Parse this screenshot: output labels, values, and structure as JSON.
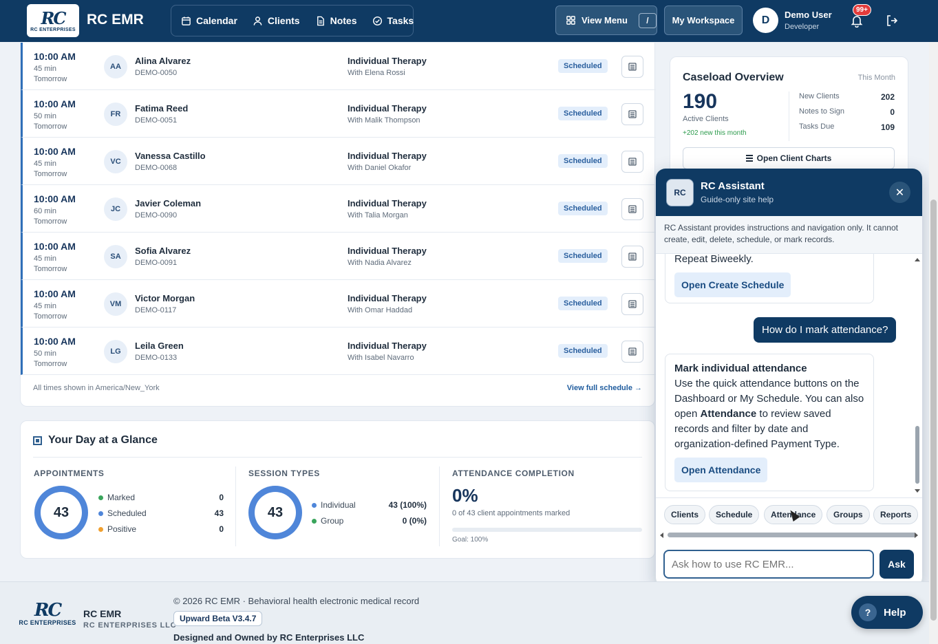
{
  "header": {
    "logo_text": "RC",
    "logo_sub": "RC ENTERPRISES",
    "app_title": "RC EMR",
    "nav": [
      {
        "label": "Calendar",
        "icon": "calendar-icon"
      },
      {
        "label": "Clients",
        "icon": "user-icon"
      },
      {
        "label": "Notes",
        "icon": "document-icon"
      },
      {
        "label": "Tasks",
        "icon": "check-circle-icon"
      }
    ],
    "view_menu_label": "View Menu",
    "view_menu_shortcut": "/",
    "workspace_label": "My Workspace",
    "user_initial": "D",
    "user_name": "Demo User",
    "user_role": "Developer",
    "notification_badge": "99+"
  },
  "appointments": {
    "rows": [
      {
        "time": "10:00 AM",
        "duration": "45 min",
        "day": "Tomorrow",
        "initials": "AA",
        "name": "Alina Alvarez",
        "client_id": "DEMO-0050",
        "type": "Individual Therapy",
        "with": "With Elena Rossi",
        "status": "Scheduled"
      },
      {
        "time": "10:00 AM",
        "duration": "50 min",
        "day": "Tomorrow",
        "initials": "FR",
        "name": "Fatima Reed",
        "client_id": "DEMO-0051",
        "type": "Individual Therapy",
        "with": "With Malik Thompson",
        "status": "Scheduled"
      },
      {
        "time": "10:00 AM",
        "duration": "45 min",
        "day": "Tomorrow",
        "initials": "VC",
        "name": "Vanessa Castillo",
        "client_id": "DEMO-0068",
        "type": "Individual Therapy",
        "with": "With Daniel Okafor",
        "status": "Scheduled"
      },
      {
        "time": "10:00 AM",
        "duration": "60 min",
        "day": "Tomorrow",
        "initials": "JC",
        "name": "Javier Coleman",
        "client_id": "DEMO-0090",
        "type": "Individual Therapy",
        "with": "With Talia Morgan",
        "status": "Scheduled"
      },
      {
        "time": "10:00 AM",
        "duration": "45 min",
        "day": "Tomorrow",
        "initials": "SA",
        "name": "Sofia Alvarez",
        "client_id": "DEMO-0091",
        "type": "Individual Therapy",
        "with": "With Nadia Alvarez",
        "status": "Scheduled"
      },
      {
        "time": "10:00 AM",
        "duration": "45 min",
        "day": "Tomorrow",
        "initials": "VM",
        "name": "Victor Morgan",
        "client_id": "DEMO-0117",
        "type": "Individual Therapy",
        "with": "With Omar Haddad",
        "status": "Scheduled"
      },
      {
        "time": "10:00 AM",
        "duration": "50 min",
        "day": "Tomorrow",
        "initials": "LG",
        "name": "Leila Green",
        "client_id": "DEMO-0133",
        "type": "Individual Therapy",
        "with": "With Isabel Navarro",
        "status": "Scheduled"
      }
    ],
    "timezone_note": "All times shown in America/New_York",
    "full_schedule_link": "View full schedule →"
  },
  "glance": {
    "title": "Your Day at a Glance",
    "appointments_heading": "APPOINTMENTS",
    "appointments_total": "43",
    "appointments_legend": [
      {
        "label": "Marked",
        "value": "0",
        "color": "#3aa55c"
      },
      {
        "label": "Scheduled",
        "value": "43",
        "color": "#4f86d9"
      },
      {
        "label": "Positive",
        "value": "0",
        "color": "#f0a030"
      }
    ],
    "session_heading": "SESSION TYPES",
    "session_total": "43",
    "session_legend": [
      {
        "label": "Individual",
        "value": "43 (100%)",
        "color": "#4f86d9"
      },
      {
        "label": "Group",
        "value": "0 (0%)",
        "color": "#3aa55c"
      }
    ],
    "attendance_heading": "ATTENDANCE COMPLETION",
    "attendance_pct": "0%",
    "attendance_fraction": 0,
    "attendance_sub": "0 of 43 client appointments marked",
    "attendance_goal": "Goal: 100%"
  },
  "caseload": {
    "title": "Caseload Overview",
    "period": "This Month",
    "active_count": "190",
    "active_label": "Active Clients",
    "new_this_month": "+202 new this month",
    "stats": [
      {
        "label": "New Clients",
        "value": "202"
      },
      {
        "label": "Notes to Sign",
        "value": "0"
      },
      {
        "label": "Tasks Due",
        "value": "109"
      }
    ],
    "open_charts_label": "Open Client Charts"
  },
  "assistant": {
    "logo": "RC",
    "title": "RC Assistant",
    "subtitle": "Guide-only site help",
    "close_symbol": "✕",
    "notice": "RC Assistant provides instructions and navigation only. It cannot create, edit, delete, schedule, or mark records.",
    "msg1_text": "Only for Today, Repeat Weekly, or Repeat Biweekly.",
    "msg1_action": "Open Create Schedule",
    "user_msg": "How do I mark attendance?",
    "msg2_title": "Mark individual attendance",
    "msg2_text_a": "Use the quick attendance buttons on the Dashboard or My Schedule. You can also open ",
    "msg2_text_bold": "Attendance",
    "msg2_text_b": " to review saved records and filter by date and organization-defined Payment Type.",
    "msg2_action": "Open Attendance",
    "chips": [
      "Clients",
      "Schedule",
      "Attendance",
      "Groups",
      "Reports"
    ],
    "input_placeholder": "Ask how to use RC EMR...",
    "ask_label": "Ask"
  },
  "footer": {
    "logo_text": "RC",
    "logo_sub": "RC ENTERPRISES",
    "name": "RC EMR",
    "company": "RC ENTERPRISES LLC",
    "copyright": "© 2026 RC EMR · Behavioral health electronic medical record",
    "version": "Upward Beta V3.4.7",
    "owned": "Designed and Owned by RC Enterprises LLC"
  },
  "help_label": "Help",
  "help_symbol": "?"
}
